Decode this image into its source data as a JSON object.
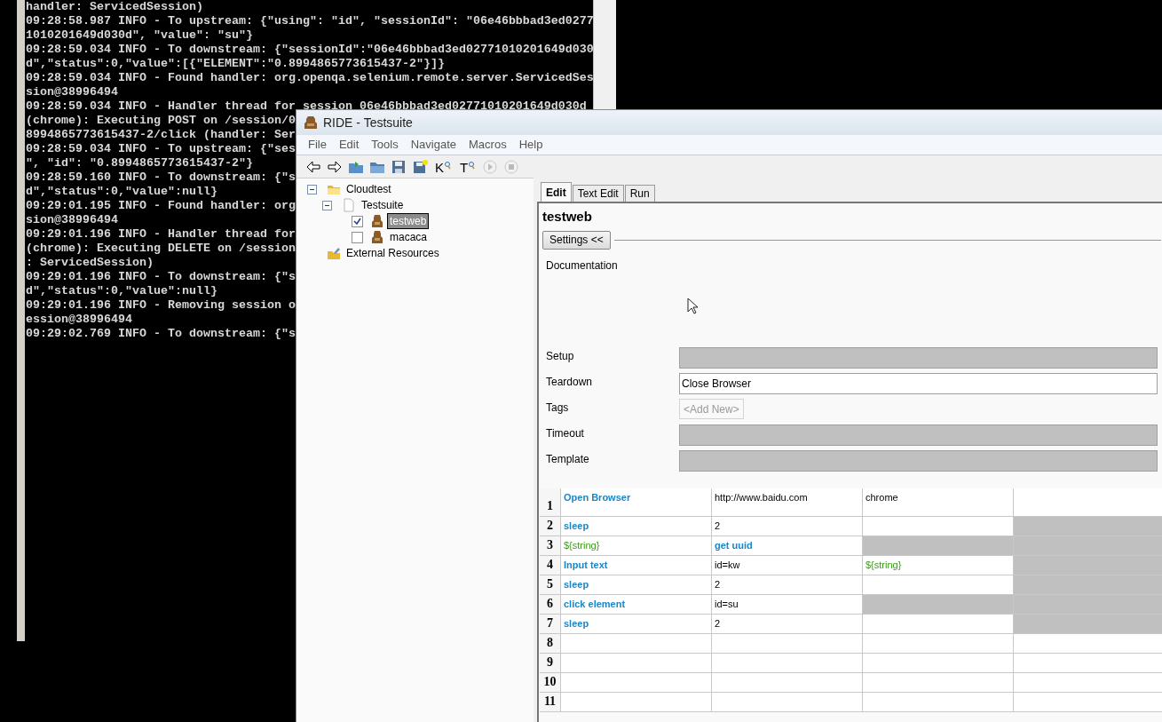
{
  "console": {
    "lines": [
      "handler: ServicedSession)",
      "09:28:58.987 INFO - To upstream: {\"using\": \"id\", \"sessionId\": \"06e46bbbad3ed0277",
      "1010201649d030d\", \"value\": \"su\"}",
      "09:28:59.034 INFO - To downstream: {\"sessionId\":\"06e46bbbad3ed02771010201649d030",
      "d\",\"status\":0,\"value\":[{\"ELEMENT\":\"0.8994865773615437-2\"}]}",
      "09:28:59.034 INFO - Found handler: org.openqa.selenium.remote.server.ServicedSes",
      "sion@38996494",
      "09:28:59.034 INFO - Handler thread for session 06e46bbbad3ed02771010201649d030d",
      "(chrome): Executing POST on /session/0",
      "8994865773615437-2/click (handler: Ser",
      "09:28:59.034 INFO - To upstream: {\"ses",
      "\", \"id\": \"0.8994865773615437-2\"}",
      "09:28:59.160 INFO - To downstream: {\"s",
      "d\",\"status\":0,\"value\":null}",
      "09:29:01.195 INFO - Found handler: org",
      "sion@38996494",
      "09:29:01.196 INFO - Handler thread for",
      "(chrome): Executing DELETE on /session",
      ": ServicedSession)",
      "09:29:01.196 INFO - To downstream: {\"s",
      "d\",\"status\":0,\"value\":null}",
      "09:29:01.196 INFO - Removing session o",
      "ession@38996494",
      "09:29:02.769 INFO - To downstream: {\"s"
    ]
  },
  "window": {
    "title": "RIDE - Testsuite"
  },
  "menu": [
    "File",
    "Edit",
    "Tools",
    "Navigate",
    "Macros",
    "Help"
  ],
  "toolbar": [
    {
      "kind": "back",
      "disabled": false
    },
    {
      "kind": "forward",
      "disabled": false
    },
    {
      "kind": "open",
      "disabled": false
    },
    {
      "kind": "folder",
      "disabled": false
    },
    {
      "kind": "save",
      "disabled": false
    },
    {
      "kind": "save_all",
      "disabled": false
    },
    {
      "kind": "search",
      "letter": "K",
      "disabled": false
    },
    {
      "kind": "search",
      "letter": "T",
      "disabled": false
    },
    {
      "kind": "run",
      "disabled": true
    },
    {
      "kind": "stop",
      "disabled": true
    }
  ],
  "tree": [
    {
      "label": "Cloudtest",
      "kind": "directory",
      "expanded": true,
      "children": [
        {
          "label": "Testsuite",
          "kind": "suite",
          "expanded": true,
          "children": [
            {
              "label": "testweb",
              "kind": "test",
              "checked": true,
              "selected": true
            },
            {
              "label": "macaca",
              "kind": "test",
              "checked": false,
              "selected": false
            }
          ]
        }
      ]
    },
    {
      "label": "External Resources",
      "kind": "resources"
    }
  ],
  "tabs": [
    {
      "label": "Edit",
      "selected": true
    },
    {
      "label": "Text Edit",
      "selected": false
    },
    {
      "label": "Run",
      "selected": false
    }
  ],
  "editor": {
    "title": "testweb",
    "settings_button": "Settings <<",
    "documentation_label": "Documentation",
    "settings": [
      {
        "label": "Setup",
        "kind": "field"
      },
      {
        "label": "Teardown",
        "kind": "field",
        "value": "Close Browser"
      },
      {
        "label": "Tags",
        "kind": "tags",
        "add_label": "<Add New>"
      },
      {
        "label": "Timeout",
        "kind": "field"
      },
      {
        "label": "Template",
        "kind": "field"
      }
    ]
  },
  "grid": {
    "rows": [
      {
        "number": "1",
        "cells": [
          {
            "kind": "keyword",
            "text": "Open Browser"
          },
          {
            "kind": "argument",
            "text": "http://www.baidu.com"
          },
          {
            "kind": "argument",
            "text": "chrome"
          },
          {
            "kind": "empty"
          }
        ]
      },
      {
        "number": "2",
        "cells": [
          {
            "kind": "keyword",
            "text": "sleep"
          },
          {
            "kind": "argument",
            "text": "2"
          },
          {
            "kind": "empty"
          },
          {
            "kind": "unused"
          }
        ]
      },
      {
        "number": "3",
        "cells": [
          {
            "kind": "variable",
            "text": "${string}"
          },
          {
            "kind": "keyword",
            "text": "get uuid"
          },
          {
            "kind": "unused"
          },
          {
            "kind": "unused"
          }
        ]
      },
      {
        "number": "4",
        "cells": [
          {
            "kind": "keyword",
            "text": "Input text"
          },
          {
            "kind": "argument",
            "text": "id=kw"
          },
          {
            "kind": "variable",
            "text": "${string}"
          },
          {
            "kind": "unused"
          }
        ]
      },
      {
        "number": "5",
        "cells": [
          {
            "kind": "keyword",
            "text": "sleep"
          },
          {
            "kind": "argument",
            "text": "2"
          },
          {
            "kind": "empty"
          },
          {
            "kind": "unused"
          }
        ]
      },
      {
        "number": "6",
        "cells": [
          {
            "kind": "keyword",
            "text": "click element"
          },
          {
            "kind": "argument",
            "text": "id=su"
          },
          {
            "kind": "unused"
          },
          {
            "kind": "unused"
          }
        ]
      },
      {
        "number": "7",
        "cells": [
          {
            "kind": "keyword",
            "text": "sleep"
          },
          {
            "kind": "argument",
            "text": "2"
          },
          {
            "kind": "empty"
          },
          {
            "kind": "unused"
          }
        ]
      },
      {
        "number": "8",
        "cells": [
          {
            "kind": "empty"
          },
          {
            "kind": "empty"
          },
          {
            "kind": "empty"
          },
          {
            "kind": "empty"
          }
        ]
      },
      {
        "number": "9",
        "cells": [
          {
            "kind": "empty"
          },
          {
            "kind": "empty"
          },
          {
            "kind": "empty"
          },
          {
            "kind": "empty"
          }
        ]
      },
      {
        "number": "10",
        "cells": [
          {
            "kind": "empty"
          },
          {
            "kind": "empty"
          },
          {
            "kind": "empty"
          },
          {
            "kind": "empty"
          }
        ]
      },
      {
        "number": "11",
        "cells": [
          {
            "kind": "empty"
          },
          {
            "kind": "empty"
          },
          {
            "kind": "empty"
          },
          {
            "kind": "empty"
          }
        ]
      }
    ]
  }
}
